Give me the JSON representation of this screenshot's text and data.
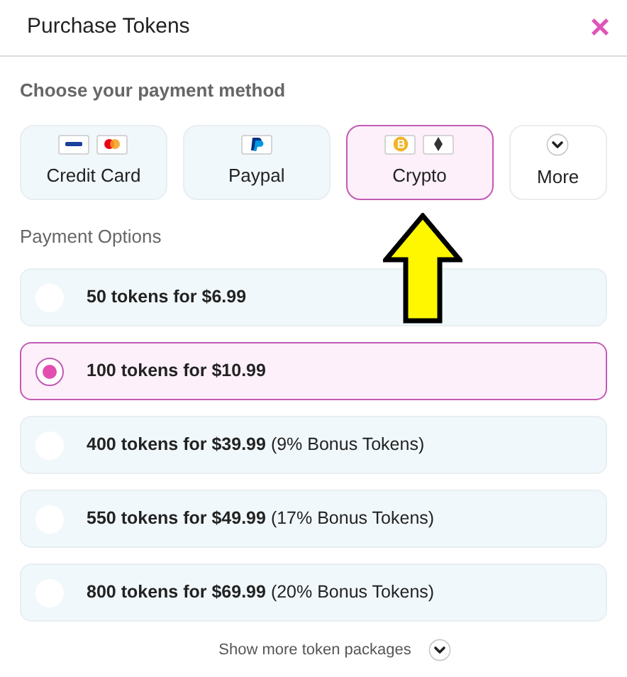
{
  "window": {
    "title": "Purchase Tokens",
    "close": "×"
  },
  "payment": {
    "heading": "Choose your payment method",
    "methods": [
      {
        "kind": "card",
        "label": "Credit Card",
        "selected": false
      },
      {
        "kind": "paypal",
        "label": "Paypal",
        "selected": false
      },
      {
        "kind": "crypto",
        "label": "Crypto",
        "selected": true
      },
      {
        "kind": "more",
        "label": "More",
        "selected": false
      }
    ]
  },
  "options": {
    "heading": "Payment Options",
    "items": [
      {
        "offer": "50 tokens for $6.99",
        "selected": false
      },
      {
        "offer": "100 tokens for $10.99",
        "selected": true
      },
      {
        "offer": "400 tokens for $39.99",
        "bonus": "(9% Bonus Tokens)",
        "selected": false
      },
      {
        "offer": "550 tokens for $49.99",
        "bonus": "(17% Bonus Tokens)",
        "selected": false
      },
      {
        "offer": "800 tokens for $69.99",
        "bonus": "(20% Bonus Tokens)",
        "selected": false
      }
    ],
    "show_more": "Show more token packages"
  }
}
